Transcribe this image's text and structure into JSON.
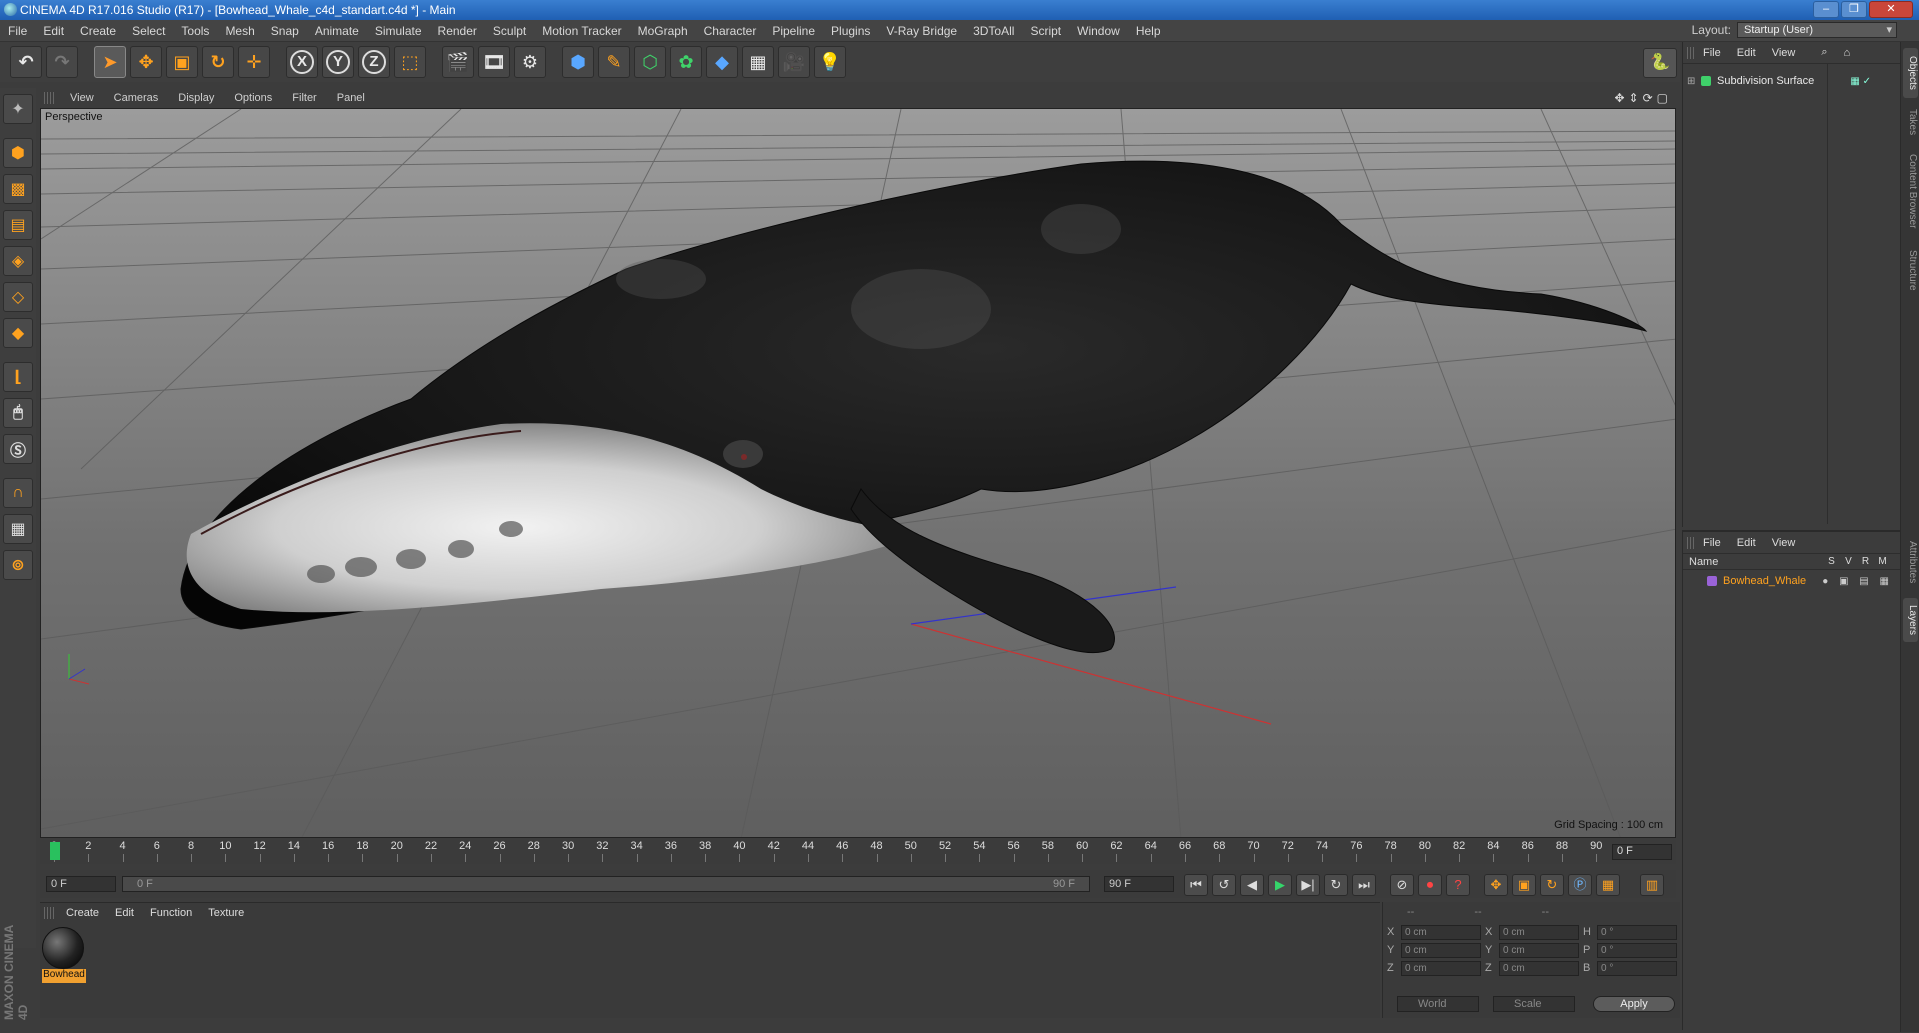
{
  "window": {
    "title": "CINEMA 4D R17.016 Studio (R17) - [Bowhead_Whale_c4d_standart.c4d *] - Main"
  },
  "menu": [
    "File",
    "Edit",
    "Create",
    "Select",
    "Tools",
    "Mesh",
    "Snap",
    "Animate",
    "Simulate",
    "Render",
    "Sculpt",
    "Motion Tracker",
    "MoGraph",
    "Character",
    "Pipeline",
    "Plugins",
    "V-Ray Bridge",
    "3DToAll",
    "Script",
    "Window",
    "Help"
  ],
  "layout": {
    "label": "Layout:",
    "value": "Startup (User)"
  },
  "toolbar": {
    "axis_x": "X",
    "axis_y": "Y",
    "axis_z": "Z"
  },
  "viewport": {
    "menu": [
      "View",
      "Cameras",
      "Display",
      "Options",
      "Filter",
      "Panel"
    ],
    "camera_label": "Perspective",
    "grid_spacing": "Grid Spacing : 100 cm"
  },
  "timeline": {
    "ticks": [
      "0",
      "2",
      "4",
      "6",
      "8",
      "10",
      "12",
      "14",
      "16",
      "18",
      "20",
      "22",
      "24",
      "26",
      "28",
      "30",
      "32",
      "34",
      "36",
      "38",
      "40",
      "42",
      "44",
      "46",
      "48",
      "50",
      "52",
      "54",
      "56",
      "58",
      "60",
      "62",
      "64",
      "66",
      "68",
      "70",
      "72",
      "74",
      "76",
      "78",
      "80",
      "82",
      "84",
      "86",
      "88",
      "90"
    ],
    "current_frame_right": "0 F",
    "start_field": "0 F",
    "range_start": "0 F",
    "range_end": "90 F",
    "end_field": "90 F"
  },
  "material_manager": {
    "menu": [
      "Create",
      "Edit",
      "Function",
      "Texture"
    ],
    "materials": [
      {
        "name": "Bowhead"
      }
    ]
  },
  "coordinates": {
    "header": [
      "--",
      "--",
      "--"
    ],
    "rows": [
      {
        "a": "X",
        "av": "0 cm",
        "b": "X",
        "bv": "0 cm",
        "c": "H",
        "cv": "0 °"
      },
      {
        "a": "Y",
        "av": "0 cm",
        "b": "Y",
        "bv": "0 cm",
        "c": "P",
        "cv": "0 °"
      },
      {
        "a": "Z",
        "av": "0 cm",
        "b": "Z",
        "bv": "0 cm",
        "c": "B",
        "cv": "0 °"
      }
    ],
    "space": "World",
    "mode": "Scale",
    "apply": "Apply"
  },
  "object_manager": {
    "menu": [
      "File",
      "Edit",
      "View"
    ],
    "objects": [
      {
        "name": "Subdivision Surface"
      }
    ]
  },
  "layer_manager": {
    "menu": [
      "File",
      "Edit",
      "View"
    ],
    "columns": {
      "name": "Name",
      "s": "S",
      "v": "V",
      "r": "R",
      "m": "M"
    },
    "layers": [
      {
        "name": "Bowhead_Whale"
      }
    ]
  },
  "right_tabs": [
    "Objects",
    "Takes",
    "Content Browser",
    "Structure",
    "Attributes",
    "Layers"
  ],
  "branding": "MAXON CINEMA 4D"
}
